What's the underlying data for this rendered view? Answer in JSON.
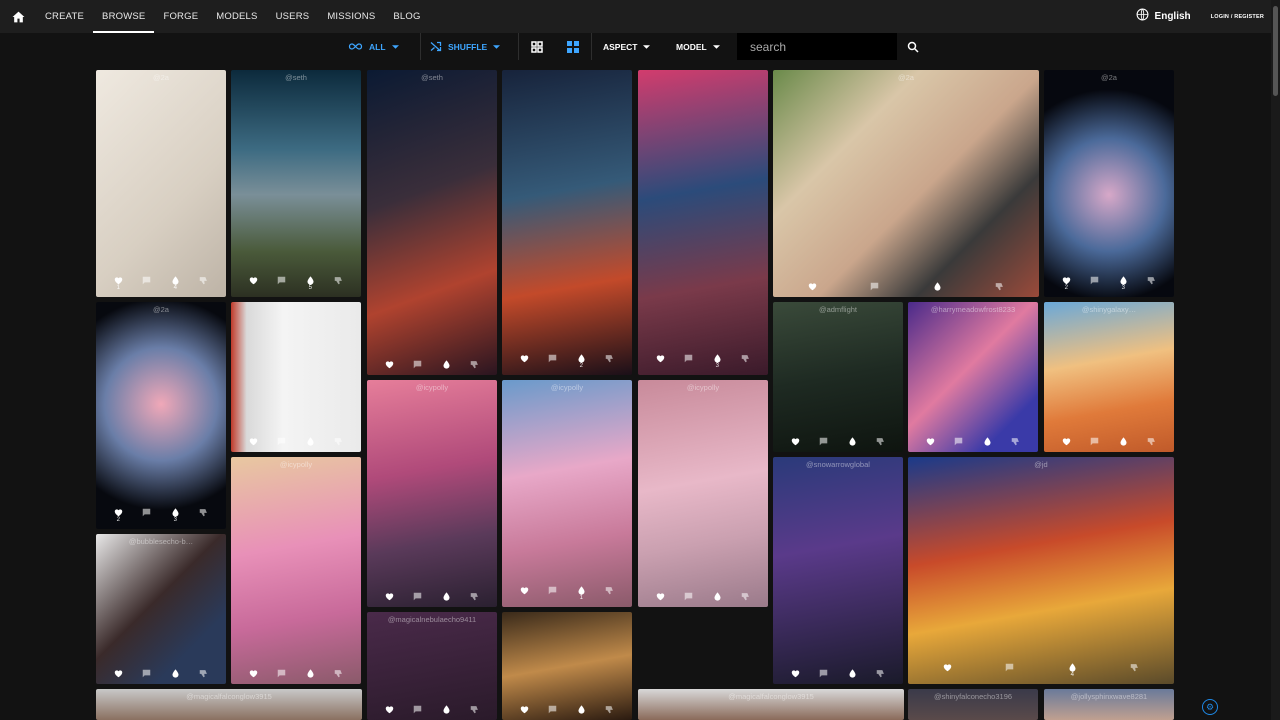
{
  "nav": {
    "items": [
      {
        "label": "CREATE",
        "active": false
      },
      {
        "label": "BROWSE",
        "active": true
      },
      {
        "label": "FORGE",
        "active": false
      },
      {
        "label": "MODELS",
        "active": false
      },
      {
        "label": "USERS",
        "active": false
      },
      {
        "label": "MISSIONS",
        "active": false
      },
      {
        "label": "BLOG",
        "active": false
      }
    ],
    "language": "English",
    "login": "LOGIN / REGISTER"
  },
  "toolbar": {
    "all_label": "ALL",
    "shuffle_label": "SHUFFLE",
    "aspect_label": "ASPECT",
    "model_label": "MODEL",
    "search_placeholder": "search"
  },
  "colors": {
    "accent": "#3ea6ff",
    "bar": "#1e1e1e",
    "background": "#121212"
  },
  "gallery": [
    {
      "id": "t1",
      "user": "@2a",
      "likes": "1",
      "tips": "4",
      "icon": "flower-embroidery"
    },
    {
      "id": "t2",
      "user": "@seth",
      "likes": "",
      "tips": "5",
      "icon": "mountain-planet"
    },
    {
      "id": "t3",
      "user": "@seth",
      "likes": "",
      "tips": "",
      "icon": "robot"
    },
    {
      "id": "t4",
      "user": "",
      "likes": "",
      "tips": "2",
      "icon": "robot"
    },
    {
      "id": "t5",
      "user": "",
      "likes": "",
      "tips": "3",
      "icon": "robot"
    },
    {
      "id": "t6",
      "user": "@2a",
      "likes": "",
      "tips": "",
      "icon": "couple-photo"
    },
    {
      "id": "t7",
      "user": "@2a",
      "likes": "2",
      "tips": "3",
      "icon": "glass-frog"
    },
    {
      "id": "t8",
      "user": "@2a",
      "likes": "2",
      "tips": "3",
      "icon": "glass-frog"
    },
    {
      "id": "t9",
      "user": "",
      "likes": "",
      "tips": "",
      "icon": "document"
    },
    {
      "id": "t10",
      "user": "@icypolly",
      "likes": "",
      "tips": "",
      "icon": "angel"
    },
    {
      "id": "t11",
      "user": "@icypolly",
      "likes": "",
      "tips": "1",
      "icon": "angel"
    },
    {
      "id": "t12",
      "user": "@icypolly",
      "likes": "",
      "tips": "",
      "icon": "angel"
    },
    {
      "id": "t13",
      "user": "@admflight",
      "likes": "",
      "tips": "",
      "icon": "creature"
    },
    {
      "id": "t14",
      "user": "@harrymeadowfrost8233",
      "likes": "",
      "tips": "",
      "icon": "selfie"
    },
    {
      "id": "t15",
      "user": "@shinygalaxy…",
      "likes": "",
      "tips": "",
      "icon": "anime"
    },
    {
      "id": "t16",
      "user": "@icypolly",
      "likes": "",
      "tips": "",
      "icon": "angel"
    },
    {
      "id": "t17",
      "user": "@bubblesecho-b…",
      "likes": "",
      "tips": "",
      "icon": "couple"
    },
    {
      "id": "t18",
      "user": "@snowarrowglobal",
      "likes": "",
      "tips": "",
      "icon": "witch"
    },
    {
      "id": "t19",
      "user": "@jd",
      "likes": "",
      "tips": "4",
      "icon": "painter"
    },
    {
      "id": "t20",
      "user": "@magicalnebulaecho9411",
      "likes": "",
      "tips": "",
      "icon": "gothic"
    },
    {
      "id": "t21",
      "user": "",
      "likes": "",
      "tips": "",
      "icon": "bar-woman"
    },
    {
      "id": "t22",
      "user": "@magicalfalconglow3915",
      "likes": "",
      "tips": "",
      "icon": "house"
    },
    {
      "id": "t23",
      "user": "@magicalfalconglow3915",
      "likes": "",
      "tips": "",
      "icon": "house"
    },
    {
      "id": "t24",
      "user": "@shinyfalconecho3196",
      "likes": "",
      "tips": "",
      "icon": "portrait"
    },
    {
      "id": "t25",
      "user": "@jollysphinxwave8281",
      "likes": "",
      "tips": "",
      "icon": "portrait"
    }
  ]
}
